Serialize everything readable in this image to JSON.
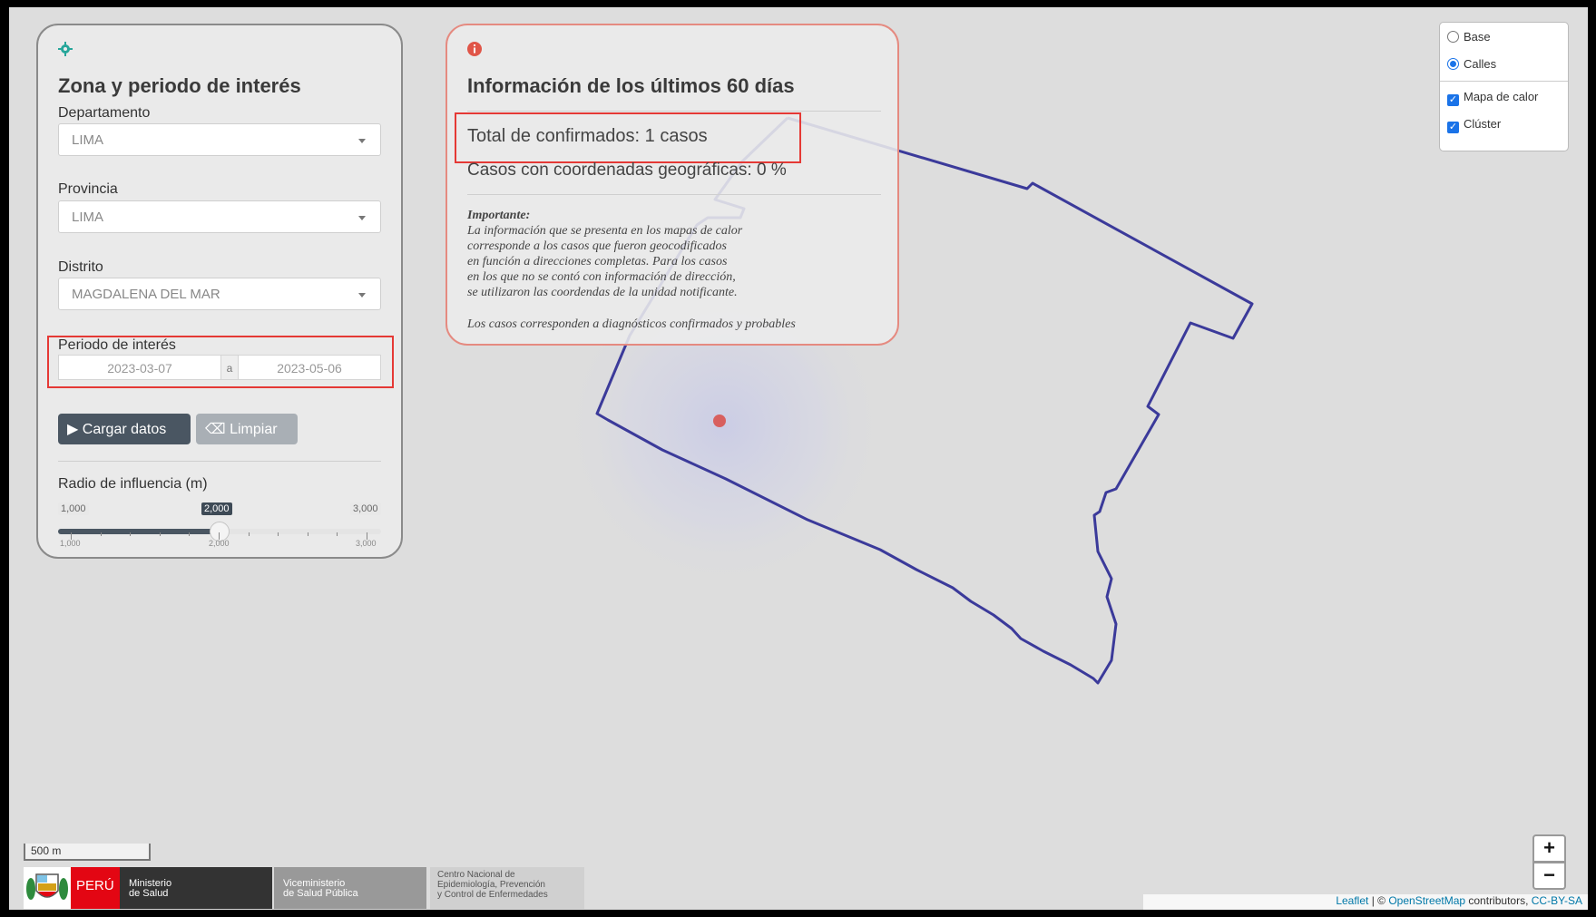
{
  "filters": {
    "title": "Zona y periodo de interés",
    "department_label": "Departamento",
    "department_value": "LIMA",
    "province_label": "Provincia",
    "province_value": "LIMA",
    "district_label": "Distrito",
    "district_value": "MAGDALENA DEL MAR",
    "period_label": "Periodo de interés",
    "date_from": "2023-03-07",
    "date_sep": "a",
    "date_to": "2023-05-06",
    "load_button": "Cargar datos",
    "clear_button": "Limpiar",
    "radius_label": "Radio de influencia (m)",
    "radius_min": "1,000",
    "radius_value": "2,000",
    "radius_max": "3,000",
    "radius_fraction": 0.5,
    "ticks": [
      "1,000",
      "2,000",
      "3,000"
    ]
  },
  "info": {
    "title": "Información de los últimos 60 días",
    "total_confirmed": "Total de confirmados: 1 casos",
    "geo_cases": "Casos con coordenadas geográficas: 0 %",
    "important_heading": "Importante:",
    "important_lines": [
      "La información que se presenta en los mapas de calor",
      "corresponde a los casos que fueron geocodificados",
      "en función a direcciones completas. Para los casos",
      "en los que no se contó con información de dirección,",
      "se utilizaron las coordendas de la unidad notificante."
    ],
    "note": "Los casos corresponden a diagnósticos confirmados y probables"
  },
  "layers": {
    "base": "Base",
    "streets": "Calles",
    "heatmap": "Mapa de calor",
    "cluster": "Clúster",
    "selected_base": "Calles",
    "heatmap_checked": true,
    "cluster_checked": true
  },
  "map": {
    "zoom_in": "+",
    "zoom_out": "−",
    "scale": "500 m",
    "attribution_leaflet": "Leaflet",
    "attribution_sep": " | © ",
    "attribution_osm": "OpenStreetMap",
    "attribution_mid": " contributors, ",
    "attribution_license": "CC-BY-SA",
    "boundary_color": "#3b3a9a",
    "case_marker_color": "#d9534f"
  },
  "footer": {
    "peru": "PERÚ",
    "ministry_line1": "Ministerio",
    "ministry_line2": "de Salud",
    "vice_line1": "Viceministerio",
    "vice_line2": "de Salud Pública",
    "center_line1": "Centro Nacional de",
    "center_line2": "Epidemiología, Prevención",
    "center_line3": "y Control de Enfermedades"
  },
  "colors": {
    "highlight": "#e53935",
    "info_border": "#e58a80",
    "peru_red": "#e30613",
    "minsa_dark": "#333333"
  }
}
